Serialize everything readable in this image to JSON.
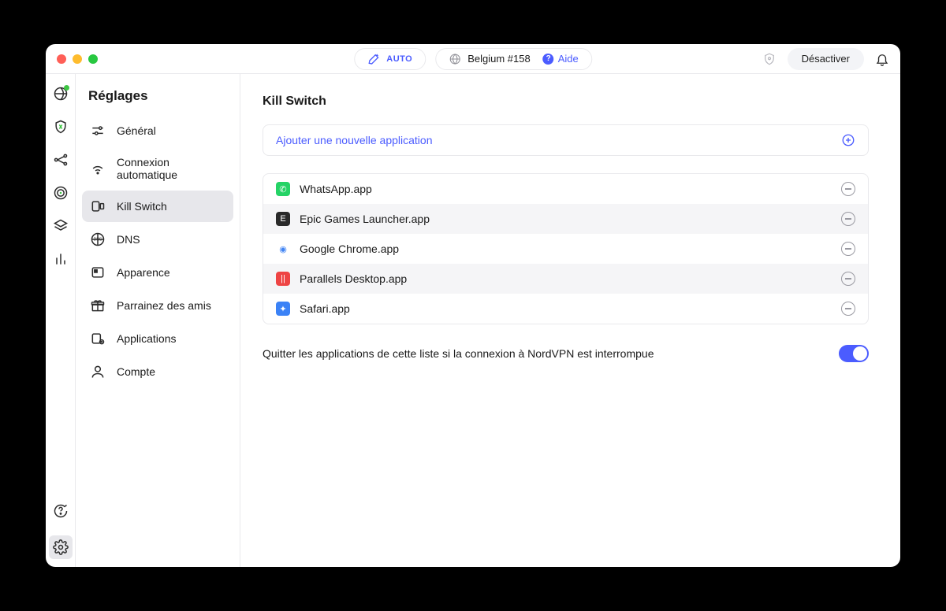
{
  "titlebar": {
    "auto_label": "AUTO",
    "server": "Belgium #158",
    "help_label": "Aide",
    "deactivate_label": "Désactiver"
  },
  "sidebar": {
    "title": "Réglages",
    "items": [
      {
        "label": "Général"
      },
      {
        "label": "Connexion automatique"
      },
      {
        "label": "Kill Switch"
      },
      {
        "label": "DNS"
      },
      {
        "label": "Apparence"
      },
      {
        "label": "Parrainez des amis"
      },
      {
        "label": "Applications"
      },
      {
        "label": "Compte"
      }
    ]
  },
  "main": {
    "title": "Kill Switch",
    "add_label": "Ajouter une nouvelle application",
    "apps": [
      {
        "name": "WhatsApp.app",
        "icon_bg": "#25d366",
        "icon_glyph": "✆"
      },
      {
        "name": "Epic Games Launcher.app",
        "icon_bg": "#2a2a2a",
        "icon_glyph": "E"
      },
      {
        "name": "Google Chrome.app",
        "icon_bg": "#ffffff",
        "icon_glyph": "◉"
      },
      {
        "name": "Parallels Desktop.app",
        "icon_bg": "#e44",
        "icon_glyph": "||"
      },
      {
        "name": "Safari.app",
        "icon_bg": "#3b82f6",
        "icon_glyph": "✦"
      }
    ],
    "toggle_text": "Quitter les applications de cette liste si la connexion à NordVPN est interrompue",
    "toggle_on": true
  }
}
